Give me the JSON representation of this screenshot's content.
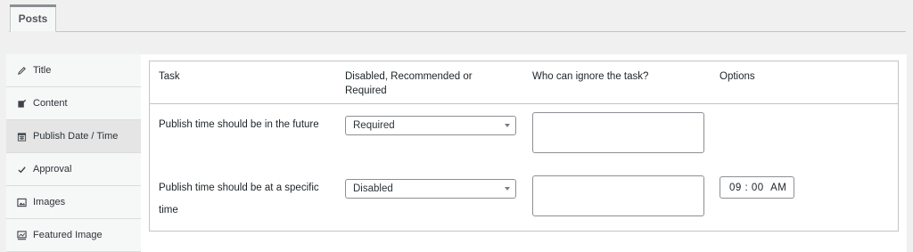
{
  "tabs": [
    {
      "label": "Posts"
    }
  ],
  "sidebar": {
    "items": [
      {
        "label": "Title",
        "icon": "pencil-icon"
      },
      {
        "label": "Content",
        "icon": "edit-page-icon"
      },
      {
        "label": "Publish Date / Time",
        "icon": "calendar-icon"
      },
      {
        "label": "Approval",
        "icon": "checkmark-icon"
      },
      {
        "label": "Images",
        "icon": "image-icon"
      },
      {
        "label": "Featured Image",
        "icon": "featured-image-icon"
      }
    ],
    "active_index": 2
  },
  "table": {
    "headers": {
      "task": "Task",
      "status": "Disabled, Recommended or Required",
      "who": "Who can ignore the task?",
      "options": "Options"
    },
    "rows": [
      {
        "task": "Publish time should be in the future",
        "status": "Required",
        "who": "",
        "options": null
      },
      {
        "task": "Publish time should be at a specific time",
        "status": "Disabled",
        "who": "",
        "options": {
          "hour": "09",
          "minute": "00",
          "period": "AM"
        }
      }
    ]
  },
  "colors": {
    "page_bg": "#f0f0f1",
    "border": "#c3c4c7",
    "active_sidebar": "#e5e5e5",
    "text": "#1d2327"
  }
}
